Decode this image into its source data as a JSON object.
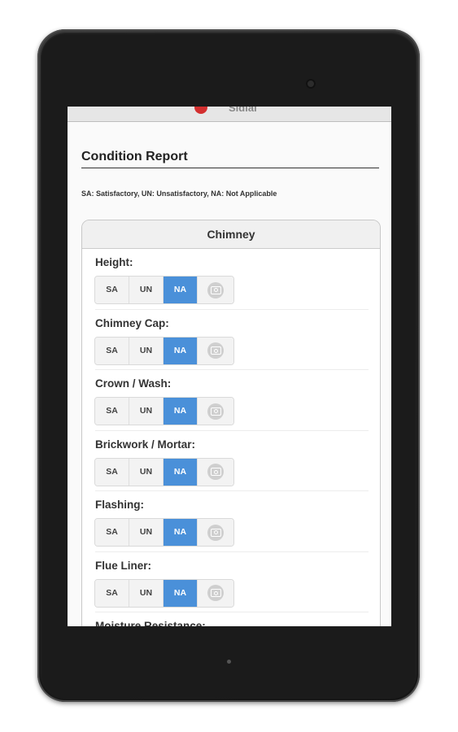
{
  "header": {
    "brand": "Sidial"
  },
  "report": {
    "title": "Condition Report",
    "legend": "SA: Satisfactory, UN: Unsatisfactory, NA: Not Applicable"
  },
  "section": {
    "title": "Chimney",
    "options": [
      "SA",
      "UN",
      "NA"
    ],
    "items": [
      {
        "label": "Height:",
        "selected": "NA"
      },
      {
        "label": "Chimney Cap:",
        "selected": "NA"
      },
      {
        "label": "Crown / Wash:",
        "selected": "NA"
      },
      {
        "label": "Brickwork / Mortar:",
        "selected": "NA"
      },
      {
        "label": "Flashing:",
        "selected": "NA"
      },
      {
        "label": "Flue Liner:",
        "selected": "NA"
      },
      {
        "label": "Moisture Resistance:",
        "selected": ""
      }
    ]
  },
  "colors": {
    "selected": "#4a90d9",
    "logo": "#d32f2f"
  },
  "icons": {
    "photo": "camera-icon"
  }
}
